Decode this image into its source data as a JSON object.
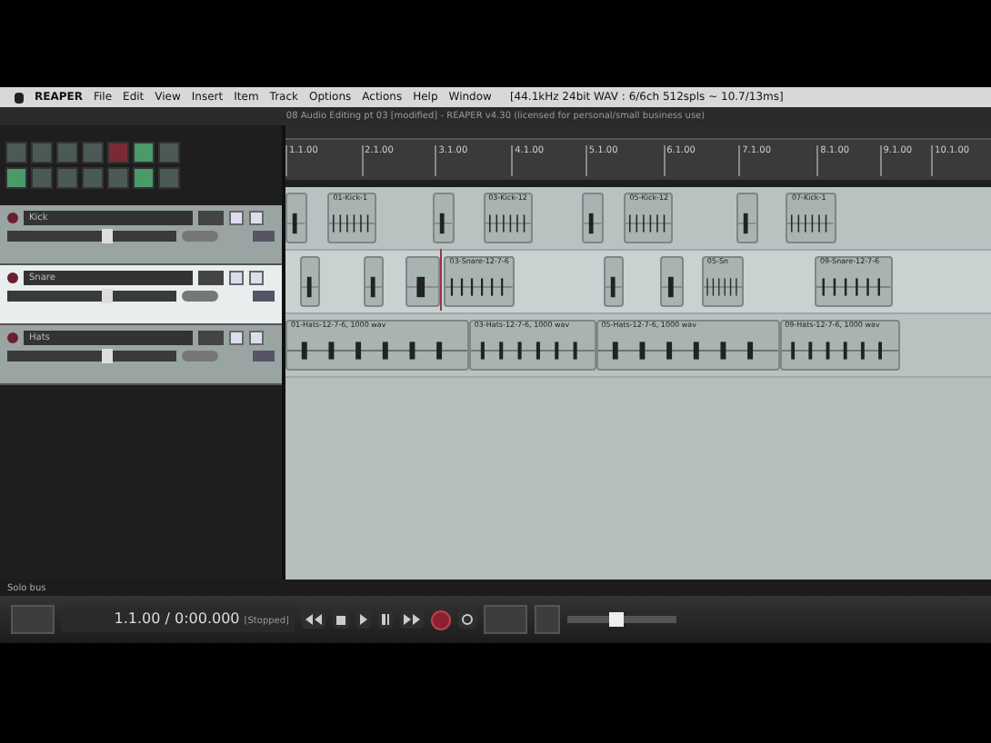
{
  "menu_bar": {
    "app": "REAPER",
    "items": [
      "File",
      "Edit",
      "View",
      "Insert",
      "Item",
      "Track",
      "Options",
      "Actions",
      "Help",
      "Window"
    ],
    "status": "[44.1kHz 24bit WAV : 6/6ch 512spls ~ 10.7/13ms]"
  },
  "window": {
    "title": "08 Audio Editing pt 03 [modified] - REAPER v4.30 (licensed for personal/small business use)"
  },
  "ruler": [
    "1.1.00",
    "2.1.00",
    "3.1.00",
    "4.1.00",
    "5.1.00",
    "6.1.00",
    "7.1.00",
    "8.1.00",
    "9.1.00",
    "10.1.00"
  ],
  "tracks": [
    {
      "name": "Kick",
      "selected": false,
      "items": [
        {
          "kind": "hit"
        },
        {
          "kind": "region",
          "label": "01-Kick-1"
        },
        {
          "kind": "hit"
        },
        {
          "kind": "region",
          "label": "03-Kick-12"
        },
        {
          "kind": "hit"
        },
        {
          "kind": "region",
          "label": "05-Kick-12"
        },
        {
          "kind": "hit"
        },
        {
          "kind": "region",
          "label": "07-Kick-1"
        }
      ]
    },
    {
      "name": "Snare",
      "selected": true,
      "items": [
        {
          "kind": "hit"
        },
        {
          "kind": "hit"
        },
        {
          "kind": "hit"
        },
        {
          "kind": "region",
          "label": "03-Snare-12-7-6"
        },
        {
          "kind": "hit"
        },
        {
          "kind": "hit"
        },
        {
          "kind": "region",
          "label": "05-Sn"
        },
        {
          "kind": "region",
          "label": "09-Snare-12-7-6"
        }
      ]
    },
    {
      "name": "Hats",
      "selected": false,
      "items": [
        {
          "kind": "region",
          "label": "01-Hats-12-7-6, 1000 wav"
        },
        {
          "kind": "region",
          "label": "03-Hats-12-7-6, 1000 wav"
        },
        {
          "kind": "region",
          "label": "05-Hats-12-7-6, 1000 wav"
        },
        {
          "kind": "region",
          "label": "09-Hats-12-7-6, 1000 wav"
        }
      ]
    }
  ],
  "status_line": "Solo bus",
  "transport": {
    "time": "1.1.00 / 0:00.000",
    "state": "[Stopped]",
    "playrate": {
      "level": 0.45
    }
  }
}
